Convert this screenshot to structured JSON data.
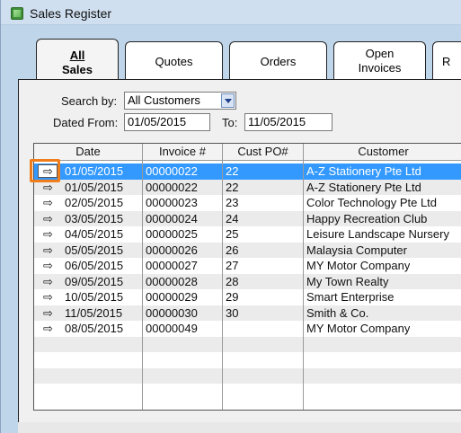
{
  "window": {
    "title": "Sales Register"
  },
  "tabs": [
    {
      "line1": "All",
      "line2": "Sales",
      "active": true
    },
    {
      "line1": "Quotes",
      "line2": "",
      "active": false
    },
    {
      "line1": "Orders",
      "line2": "",
      "active": false
    },
    {
      "line1": "Open",
      "line2": "Invoices",
      "active": false
    },
    {
      "line1": "R",
      "line2": "",
      "active": false
    }
  ],
  "filters": {
    "search_by_label": "Search by:",
    "search_by_value": "All Customers",
    "dated_from_label": "Dated From:",
    "dated_from_value": "01/05/2015",
    "to_label": "To:",
    "to_value": "11/05/2015"
  },
  "grid": {
    "columns": [
      "Date",
      "Invoice #",
      "Cust PO#",
      "Customer"
    ],
    "rows": [
      {
        "date": "01/05/2015",
        "invoice": "00000022",
        "po": "22",
        "customer": "A-Z Stationery Pte Ltd",
        "selected": true
      },
      {
        "date": "01/05/2015",
        "invoice": "00000022",
        "po": "22",
        "customer": "A-Z Stationery Pte Ltd"
      },
      {
        "date": "02/05/2015",
        "invoice": "00000023",
        "po": "23",
        "customer": "Color Technology Pte Ltd"
      },
      {
        "date": "03/05/2015",
        "invoice": "00000024",
        "po": "24",
        "customer": "Happy Recreation Club"
      },
      {
        "date": "04/05/2015",
        "invoice": "00000025",
        "po": "25",
        "customer": "Leisure Landscape Nursery"
      },
      {
        "date": "05/05/2015",
        "invoice": "00000026",
        "po": "26",
        "customer": "Malaysia Computer"
      },
      {
        "date": "06/05/2015",
        "invoice": "00000027",
        "po": "27",
        "customer": "MY Motor Company"
      },
      {
        "date": "09/05/2015",
        "invoice": "00000028",
        "po": "28",
        "customer": "My Town Realty"
      },
      {
        "date": "10/05/2015",
        "invoice": "00000029",
        "po": "29",
        "customer": "Smart Enterprise"
      },
      {
        "date": "11/05/2015",
        "invoice": "00000030",
        "po": "30",
        "customer": "Smith & Co."
      },
      {
        "date": "08/05/2015",
        "invoice": "00000049",
        "po": "",
        "customer": "MY Motor Company"
      }
    ],
    "arrow_glyph": "⇨"
  },
  "colors": {
    "selection": "#3399ff",
    "highlight": "#f07d1b",
    "window_bg": "#bfd5ea"
  }
}
